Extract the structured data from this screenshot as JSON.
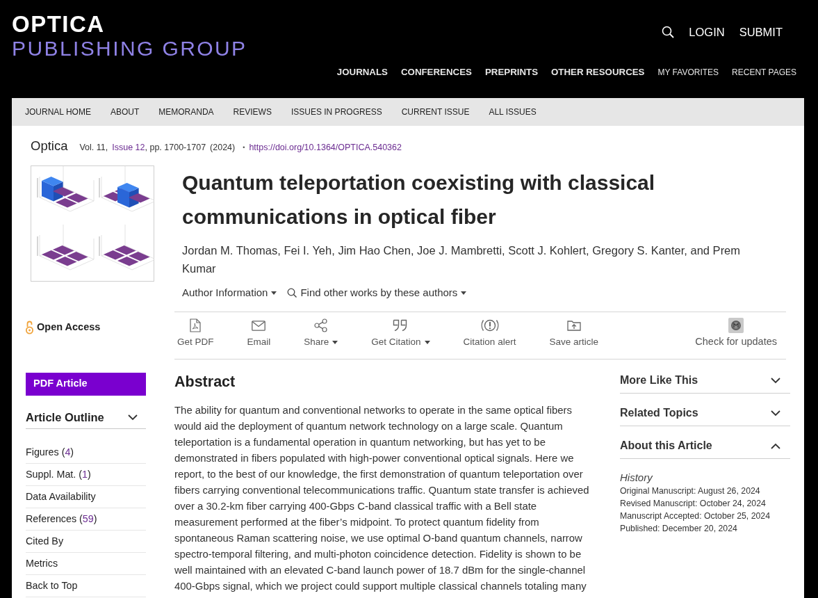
{
  "header": {
    "logo": {
      "line_1": "OPTICA",
      "line_2": "PUBLISHING GROUP"
    },
    "account_links": [
      "LOGIN",
      "SUBMIT"
    ],
    "main_nav": [
      {
        "label": "JOURNALS",
        "kind": "primary"
      },
      {
        "label": "CONFERENCES",
        "kind": "primary"
      },
      {
        "label": "PREPRINTS",
        "kind": "primary"
      },
      {
        "label": "OTHER RESOURCES",
        "kind": "primary"
      },
      {
        "label": "MY FAVORITES",
        "kind": "secondary"
      },
      {
        "label": "RECENT PAGES",
        "kind": "secondary"
      }
    ]
  },
  "journal_nav": [
    "JOURNAL HOME",
    "ABOUT",
    "MEMORANDA",
    "REVIEWS",
    "ISSUES IN PROGRESS",
    "CURRENT ISSUE",
    "ALL ISSUES"
  ],
  "citation": {
    "journal": "Optica",
    "segments": [
      {
        "text": "Vol. 11,",
        "kind": "plain"
      },
      {
        "text": "Issue 12",
        "kind": "link"
      },
      {
        "text": ", pp. 1700-1707",
        "kind": "plain"
      },
      {
        "text": "(2024)",
        "kind": "plain"
      },
      {
        "text": "•",
        "kind": "separator"
      },
      {
        "text": "https://doi.org/10.1364/OPTICA.540362",
        "kind": "link"
      }
    ]
  },
  "article": {
    "title": "Quantum teleportation coexisting with classical communications in optical fiber",
    "authors": "Jordan M. Thomas, Fei I. Yeh, Jim Hao Chen, Joe J. Mambretti, Scott J. Kohlert, Gregory S. Kanter, and Prem Kumar",
    "author_info": "Author Information",
    "find_works": "Find other works by these authors"
  },
  "access": "Open Access",
  "actions": [
    {
      "label": "Get PDF",
      "has_menu": false
    },
    {
      "label": "Email",
      "has_menu": false
    },
    {
      "label": "Share",
      "has_menu": true
    },
    {
      "label": "Get Citation",
      "has_menu": true
    },
    {
      "label": "Citation alert",
      "has_menu": false
    },
    {
      "label": "Save article",
      "has_menu": false
    }
  ],
  "check_updates": "Check for updates",
  "sidebar": {
    "pdf_button": "PDF Article",
    "outline_title": "Article Outline",
    "outline": [
      {
        "segments": [
          {
            "text": "Figures (",
            "kind": "plain"
          },
          {
            "text": "4",
            "kind": "count"
          },
          {
            "text": ")",
            "kind": "plain"
          }
        ]
      },
      {
        "segments": [
          {
            "text": "Suppl. Mat. (",
            "kind": "plain"
          },
          {
            "text": "1",
            "kind": "count"
          },
          {
            "text": ")",
            "kind": "plain"
          }
        ]
      },
      {
        "segments": [
          {
            "text": "Data Availability",
            "kind": "plain"
          }
        ]
      },
      {
        "segments": [
          {
            "text": "References (",
            "kind": "plain"
          },
          {
            "text": "59",
            "kind": "count"
          },
          {
            "text": ")",
            "kind": "plain"
          }
        ]
      },
      {
        "segments": [
          {
            "text": "Cited By",
            "kind": "plain"
          }
        ]
      },
      {
        "segments": [
          {
            "text": "Metrics",
            "kind": "plain"
          }
        ]
      },
      {
        "segments": [
          {
            "text": "Back to Top",
            "kind": "plain"
          }
        ]
      }
    ]
  },
  "abstract": {
    "heading": "Abstract",
    "text": "The ability for quantum and conventional networks to operate in the same optical fibers would aid the deployment of quantum network technology on a large scale. Quantum teleportation is a fundamental operation in quantum networking, but has yet to be demonstrated in fibers populated with high-power conventional optical signals. Here we report, to the best of our knowledge, the first demonstration of quantum teleportation over fibers carrying conventional telecommunications traffic. Quantum state transfer is achieved over a 30.2-km fiber carrying 400-Gbps C-band classical traffic with a Bell state measurement performed at the fiber’s midpoint. To protect quantum fidelity from spontaneous Raman scattering noise, we use optimal O-band quantum channels, narrow spectro-temporal filtering, and multi-photon coincidence detection. Fidelity is shown to be well maintained with an elevated C-band launch power of 18.7 dBm for the single-channel 400-Gbps signal, which we project could support multiple classical channels totaling many"
  },
  "panels": [
    {
      "title": "More Like This",
      "expanded": false
    },
    {
      "title": "Related Topics",
      "expanded": false
    },
    {
      "title": "About this Article",
      "expanded": true,
      "history": {
        "heading": "History",
        "entries": [
          "Original Manuscript: August 26, 2024",
          "Revised Manuscript: October 24, 2024",
          "Manuscript Accepted: October 25, 2024",
          "Published: December 20, 2024"
        ]
      }
    }
  ]
}
